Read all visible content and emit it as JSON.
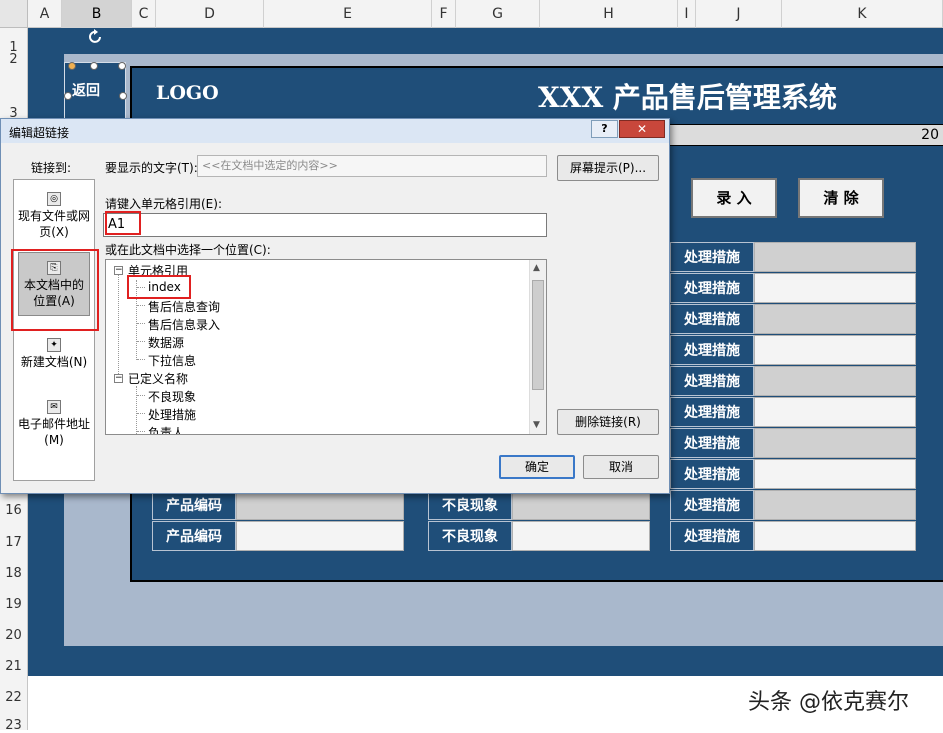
{
  "spreadsheet": {
    "columns": [
      "A",
      "B",
      "C",
      "D",
      "E",
      "F",
      "G",
      "H",
      "I",
      "J",
      "K"
    ],
    "rows": [
      "1",
      "2",
      "3",
      "16",
      "17",
      "18",
      "19",
      "20",
      "21",
      "22",
      "23"
    ]
  },
  "sheet": {
    "back_button": "返回",
    "logo": "LOGO",
    "title": "XXX 产品售后管理系统",
    "date_fragment": "20",
    "enter_button": "录 入",
    "clear_button": "清 除",
    "label_product_code": "产品编码",
    "label_defect": "不良现象",
    "label_measure": "处理措施"
  },
  "dialog": {
    "title": "编辑超链接",
    "help": "?",
    "close": "✕",
    "link_to_label": "链接到:",
    "link_options": [
      {
        "label": "现有文件或网页(X)"
      },
      {
        "label": "本文档中的位置(A)"
      },
      {
        "label": "新建文档(N)"
      },
      {
        "label": "电子邮件地址(M)"
      }
    ],
    "display_text_label": "要显示的文字(T):",
    "display_text_placeholder": "<<在文档中选定的内容>>",
    "screen_tip_button": "屏幕提示(P)...",
    "cell_ref_label": "请键入单元格引用(E):",
    "cell_ref_value": "A1",
    "place_label": "或在此文档中选择一个位置(C):",
    "tree": {
      "group1": "单元格引用",
      "group1_items": [
        "index",
        "售后信息查询",
        "售后信息录入",
        "数据源",
        "下拉信息"
      ],
      "group2": "已定义名称",
      "group2_items": [
        "不良现象",
        "处理措施",
        "负责人"
      ]
    },
    "remove_link_button": "删除链接(R)",
    "ok_button": "确定",
    "cancel_button": "取消"
  },
  "watermark": "头条 @依克赛尔",
  "colors": {
    "navy": "#1f4e79",
    "highlight_red": "#e02020"
  }
}
